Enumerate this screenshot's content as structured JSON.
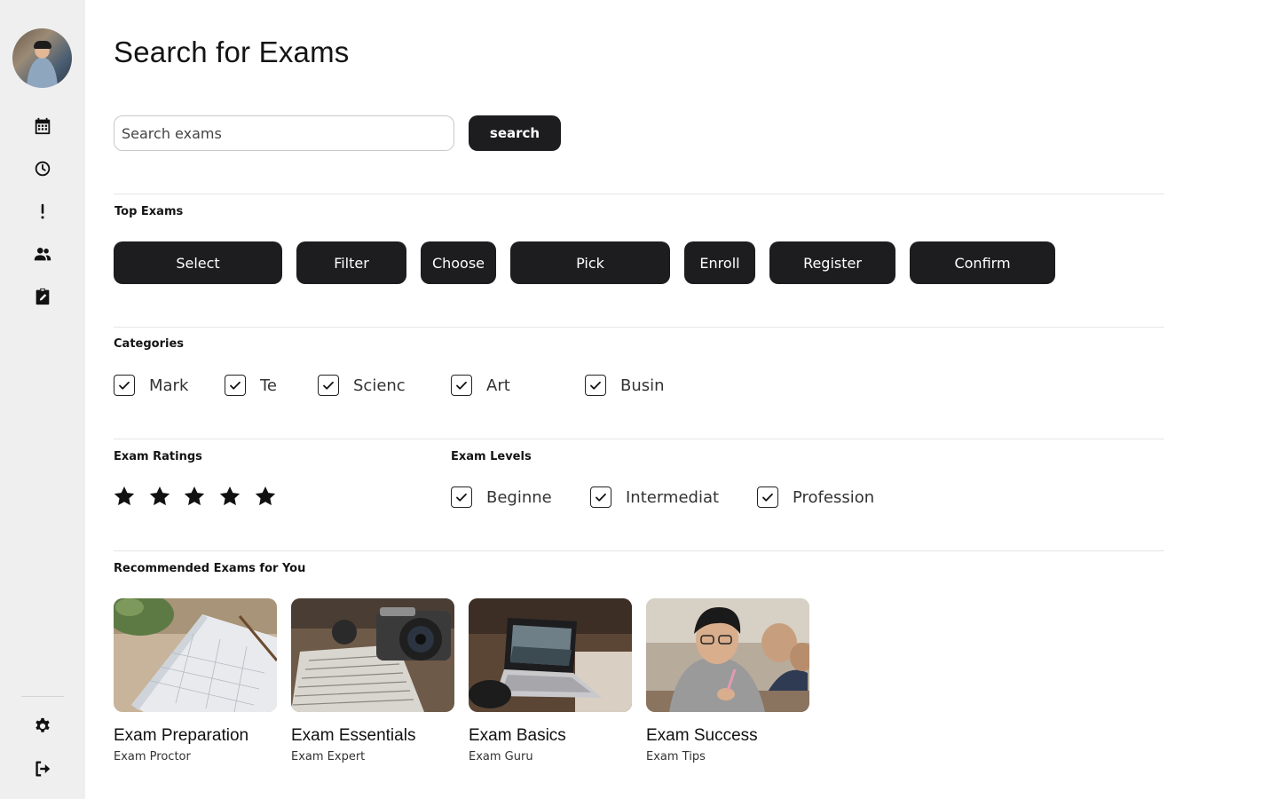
{
  "sidebar": {
    "nav": [
      {
        "icon": "calendar-icon"
      },
      {
        "icon": "clock-icon"
      },
      {
        "icon": "alert-icon"
      },
      {
        "icon": "users-icon"
      },
      {
        "icon": "clipboard-edit-icon"
      }
    ],
    "bottom": [
      {
        "icon": "gear-icon"
      },
      {
        "icon": "logout-icon"
      }
    ]
  },
  "page": {
    "title": "Search for Exams"
  },
  "search": {
    "placeholder": "Search exams",
    "button_label": "search"
  },
  "top_exams": {
    "label": "Top Exams",
    "buttons": [
      "Select",
      "Filter",
      "Choose",
      "Pick",
      "Enroll",
      "Register",
      "Confirm"
    ]
  },
  "categories": {
    "label": "Categories",
    "items": [
      {
        "label": "Mark",
        "checked": true
      },
      {
        "label": "Te",
        "checked": true
      },
      {
        "label": "Scienc",
        "checked": true
      },
      {
        "label": "Art",
        "checked": true
      },
      {
        "label": "Busin",
        "checked": true
      }
    ]
  },
  "ratings": {
    "label": "Exam Ratings",
    "value": 5,
    "max": 5
  },
  "levels": {
    "label": "Exam Levels",
    "items": [
      {
        "label": "Beginne",
        "checked": true
      },
      {
        "label": "Intermediat",
        "checked": true
      },
      {
        "label": "Profession",
        "checked": true
      }
    ]
  },
  "recommended": {
    "label": "Recommended Exams for You",
    "cards": [
      {
        "title": "Exam Preparation",
        "subtitle": "Exam Proctor",
        "image": "calendar-planner-photo"
      },
      {
        "title": "Exam Essentials",
        "subtitle": "Exam Expert",
        "image": "camera-notes-photo"
      },
      {
        "title": "Exam Basics",
        "subtitle": "Exam Guru",
        "image": "laptop-photo"
      },
      {
        "title": "Exam Success",
        "subtitle": "Exam Tips",
        "image": "student-writing-photo"
      }
    ]
  },
  "colors": {
    "sidebar_bg": "#efefef",
    "button_bg": "#1d1d1f",
    "button_text": "#ffffff",
    "divider": "#e6e6e6"
  }
}
